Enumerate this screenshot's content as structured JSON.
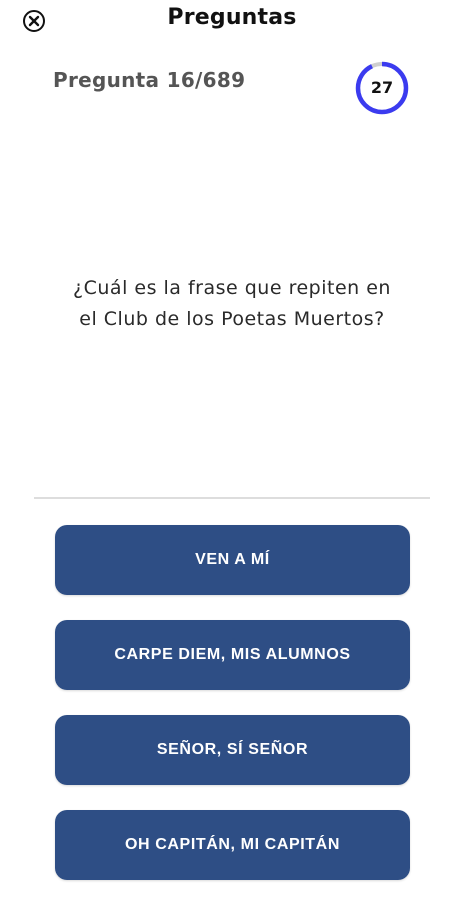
{
  "header": {
    "title": "Preguntas",
    "close_icon": "close-circle-icon"
  },
  "progress": {
    "counter_text": "Pregunta 16/689",
    "current_question": 16,
    "total_questions": 689
  },
  "timer": {
    "value": "27",
    "ring_fraction": 0.93,
    "ring_color": "#3b3bef",
    "track_color": "#cfcfcf"
  },
  "question": {
    "line1": "¿Cuál es la frase que repiten en",
    "line2": "el Club de los Poetas Muertos?"
  },
  "answers": [
    {
      "label": "VEN A MÍ"
    },
    {
      "label": "CARPE DIEM, MIS ALUMNOS"
    },
    {
      "label": "SEÑOR, SÍ SEÑOR"
    },
    {
      "label": "OH CAPITÁN, MI CAPITÁN"
    }
  ],
  "colors": {
    "answer_background": "#2e4e85",
    "answer_text": "#ffffff",
    "divider": "#dddddd"
  }
}
